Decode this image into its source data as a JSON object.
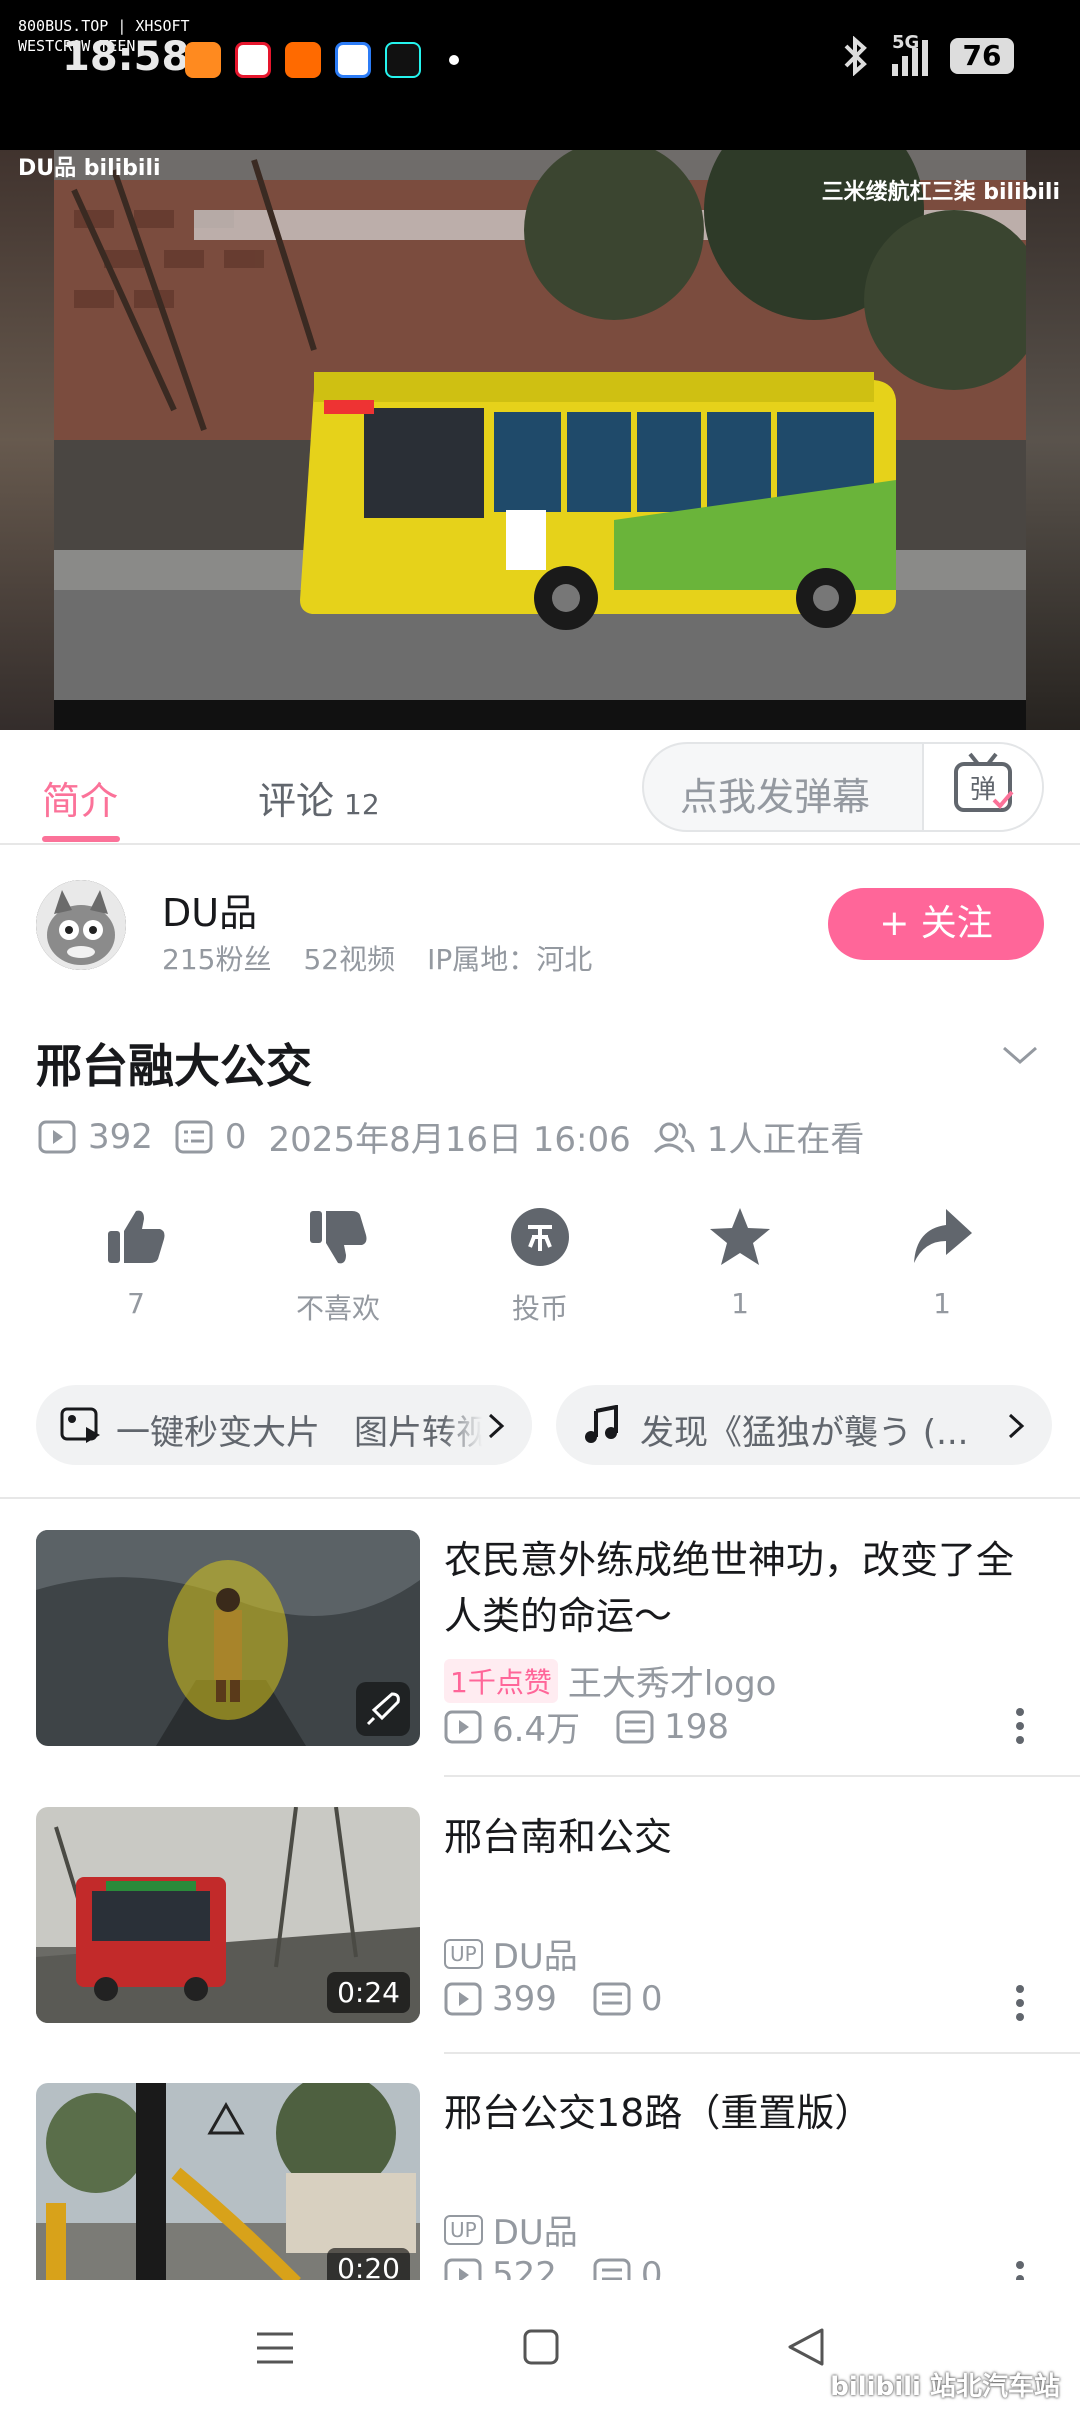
{
  "status_bar": {
    "watermark_line1": "800BUS.TOP | XHSOFT",
    "watermark_line2": "WESTCROW TEEN",
    "time": "18:58",
    "network": "5G",
    "battery": "76"
  },
  "video": {
    "watermark_left": "DU品 bilibili",
    "watermark_right": "三米缕航杠三柒 bilibili"
  },
  "tabs": {
    "intro": "简介",
    "comments": "评论",
    "comments_count": "12",
    "danmaku_placeholder": "点我发弹幕",
    "danmaku_button": "弹"
  },
  "uploader": {
    "name": "DU品",
    "fans": "215粉丝",
    "videos": "52视频",
    "ip": "IP属地：河北",
    "follow_label": "+ 关注"
  },
  "video_info": {
    "title": "邢台融大公交",
    "views": "392",
    "danmaku_count": "0",
    "date": "2025年8月16日 16:06",
    "watching": "1人正在看"
  },
  "actions": {
    "like": "7",
    "dislike": "不喜欢",
    "coin": "投币",
    "favorite": "1",
    "share": "1"
  },
  "pills": {
    "left": "一键秒变大片　图片转视",
    "right": "发现《猛独が襲う (..."
  },
  "recommendations": [
    {
      "title": "农民意外练成绝世神功，改变了全人类的命运～",
      "badge": "1千点赞",
      "author": "王大秀才logo",
      "views": "6.4万",
      "danmaku": "198",
      "duration": ""
    },
    {
      "title": "邢台南和公交",
      "author": "DU品",
      "views": "399",
      "danmaku": "0",
      "duration": "0:24"
    },
    {
      "title": "邢台公交18路（重置版）",
      "author": "DU品",
      "views": "522",
      "danmaku": "0",
      "duration": "0:20"
    }
  ],
  "footer_watermark": "bilibili 站北汽车站",
  "colors": {
    "accent": "#fb7299",
    "follow_button": "#ff6699",
    "muted": "#9499a0"
  }
}
